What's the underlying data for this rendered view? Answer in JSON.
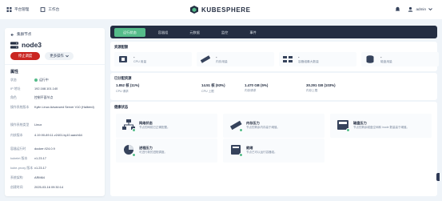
{
  "topbar": {
    "platform_label": "平台管理",
    "workbench_label": "工作台",
    "logo_text": "KUBESPHERE",
    "user_name": "admin"
  },
  "node": {
    "back_label": "集群节点",
    "name": "node3",
    "stop_button": "停止调度",
    "more_button": "更多操作"
  },
  "attributes": {
    "title": "属性",
    "rows": [
      {
        "key": "状态",
        "value": "运行中"
      },
      {
        "key": "IP 地址",
        "value": "192.168.101.140"
      },
      {
        "key": "角色",
        "value": "控制平面节点"
      },
      {
        "key": "操作系统版本",
        "value": "Kylin Linux Advanced Server V10 (Halberd)"
      },
      {
        "key": "操作系统类型",
        "value": "Linux"
      },
      {
        "key": "内核版本",
        "value": "4.19.90-89.11.v2401.ky10.aarch64"
      },
      {
        "key": "容器运行时",
        "value": "docker://24.0.9"
      },
      {
        "key": "kubelet 版本",
        "value": "v1.23.17"
      },
      {
        "key": "kube-proxy 版本",
        "value": "v1.23.17"
      },
      {
        "key": "系统架构",
        "value": "ARM64"
      },
      {
        "key": "创建时间",
        "value": "2025-03-16 09:30:14"
      }
    ]
  },
  "tabs": [
    {
      "label": "运行状态",
      "active": true
    },
    {
      "label": "容器组",
      "active": false
    },
    {
      "label": "元数据",
      "active": false
    },
    {
      "label": "监控",
      "active": false
    },
    {
      "label": "事件",
      "active": false
    }
  ],
  "resources": {
    "title": "资源配额",
    "items": [
      {
        "value": "-",
        "label": "CPU 用量",
        "icon": "cpu-icon"
      },
      {
        "value": "-",
        "label": "内存用量",
        "icon": "memory-icon"
      },
      {
        "value": "-",
        "label": "容器组最大数量",
        "icon": "pod-icon"
      },
      {
        "value": "-",
        "label": "磁盘用量",
        "icon": "disk-icon"
      }
    ]
  },
  "allocation": {
    "title": "已分配资源",
    "items": [
      {
        "value": "1.852 核 (11%)",
        "label": "CPU 请求"
      },
      {
        "value": "14.51 核 (93%)",
        "label": "CPU 上限"
      },
      {
        "value": "1.470 GB (5%)",
        "label": "内存请求"
      },
      {
        "value": "30.291 GB (103%)",
        "label": "内存上限"
      }
    ]
  },
  "health": {
    "title": "健康状态",
    "cards": [
      {
        "title": "网络状态",
        "desc": "节点的网络已正确配置。",
        "icon": "network-icon"
      },
      {
        "title": "内存压力",
        "desc": "节点的剩余内存高于阈值。",
        "icon": "memory-pressure-icon"
      },
      {
        "title": "磁盘压力",
        "desc": "节点的剩余磁盘空间和 inode 数量高于阈值。",
        "icon": "disk-pressure-icon"
      },
      {
        "title": "进程压力",
        "desc": "可进行新的进程调度。",
        "icon": "pid-pressure-icon"
      },
      {
        "title": "就绪",
        "desc": "节点已可以运行容器组。",
        "icon": "ready-icon"
      }
    ]
  },
  "colors": {
    "accent": "#55bc8a",
    "danger": "#ca2621",
    "dark": "#242e42",
    "background": "#eff4f9"
  }
}
